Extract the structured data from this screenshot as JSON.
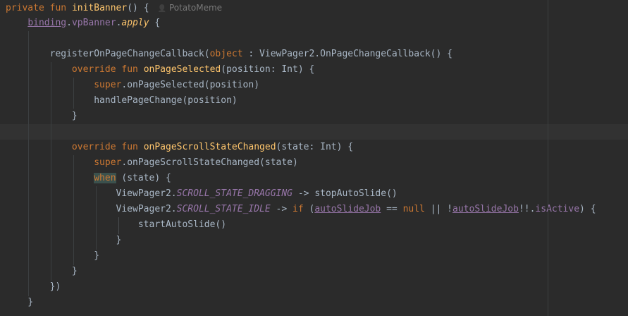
{
  "editor": {
    "author": "PotatoMeme",
    "lines": [
      {
        "segments": [
          {
            "t": "private",
            "c": "kw"
          },
          {
            "t": " "
          },
          {
            "t": "fun",
            "c": "kw"
          },
          {
            "t": " "
          },
          {
            "t": "initBanner",
            "c": "fn"
          },
          {
            "t": "() {"
          }
        ],
        "author": true
      },
      {
        "segments": [
          {
            "t": "    "
          },
          {
            "t": "binding",
            "c": "prop ul"
          },
          {
            "t": "."
          },
          {
            "t": "vpBanner",
            "c": "prop"
          },
          {
            "t": "."
          },
          {
            "t": "apply",
            "c": "fn italic"
          },
          {
            "t": " {"
          }
        ]
      },
      {
        "segments": []
      },
      {
        "segments": [
          {
            "t": "        registerOnPageChangeCallback("
          },
          {
            "t": "object",
            "c": "kw"
          },
          {
            "t": " : ViewPager2.OnPageChangeCallback() {"
          }
        ]
      },
      {
        "segments": [
          {
            "t": "            "
          },
          {
            "t": "override",
            "c": "kw"
          },
          {
            "t": " "
          },
          {
            "t": "fun",
            "c": "kw"
          },
          {
            "t": " "
          },
          {
            "t": "onPageSelected",
            "c": "fn"
          },
          {
            "t": "(position: Int) {"
          }
        ]
      },
      {
        "segments": [
          {
            "t": "                "
          },
          {
            "t": "super",
            "c": "kw"
          },
          {
            "t": ".onPageSelected(position)"
          }
        ]
      },
      {
        "segments": [
          {
            "t": "                handlePageChange(position)"
          }
        ]
      },
      {
        "segments": [
          {
            "t": "            }"
          }
        ]
      },
      {
        "segments": [],
        "highlight": true
      },
      {
        "segments": [
          {
            "t": "            "
          },
          {
            "t": "override",
            "c": "kw"
          },
          {
            "t": " "
          },
          {
            "t": "fun",
            "c": "kw"
          },
          {
            "t": " "
          },
          {
            "t": "onPageScrollStateChanged",
            "c": "fn"
          },
          {
            "t": "(state: Int) {"
          }
        ]
      },
      {
        "segments": [
          {
            "t": "                "
          },
          {
            "t": "super",
            "c": "kw"
          },
          {
            "t": ".onPageScrollStateChanged(state)"
          }
        ]
      },
      {
        "segments": [
          {
            "t": "                "
          },
          {
            "t": "when",
            "c": "when-bg"
          },
          {
            "t": " (state) {"
          }
        ]
      },
      {
        "segments": [
          {
            "t": "                    ViewPager2."
          },
          {
            "t": "SCROLL_STATE_DRAGGING",
            "c": "prop italic"
          },
          {
            "t": " -> stopAutoSlide()"
          }
        ]
      },
      {
        "segments": [
          {
            "t": "                    ViewPager2."
          },
          {
            "t": "SCROLL_STATE_IDLE",
            "c": "prop italic"
          },
          {
            "t": " -> "
          },
          {
            "t": "if",
            "c": "kw"
          },
          {
            "t": " ("
          },
          {
            "t": "autoSlideJob",
            "c": "prop ul"
          },
          {
            "t": " == "
          },
          {
            "t": "null",
            "c": "kw"
          },
          {
            "t": " || !"
          },
          {
            "t": "autoSlideJob",
            "c": "prop ul"
          },
          {
            "t": "!!."
          },
          {
            "t": "isActive",
            "c": "prop"
          },
          {
            "t": ") {"
          }
        ]
      },
      {
        "segments": [
          {
            "t": "                        startAutoSlide()"
          }
        ]
      },
      {
        "segments": [
          {
            "t": "                    }"
          }
        ]
      },
      {
        "segments": [
          {
            "t": "                }"
          }
        ]
      },
      {
        "segments": [
          {
            "t": "            }"
          }
        ]
      },
      {
        "segments": [
          {
            "t": "        })"
          }
        ]
      },
      {
        "segments": [
          {
            "t": "    }"
          }
        ]
      }
    ]
  },
  "colors": {
    "background": "#2b2b2b",
    "keyword": "#cc7832",
    "function": "#ffc66d",
    "property": "#9876aa",
    "text": "#a9b7c6"
  }
}
